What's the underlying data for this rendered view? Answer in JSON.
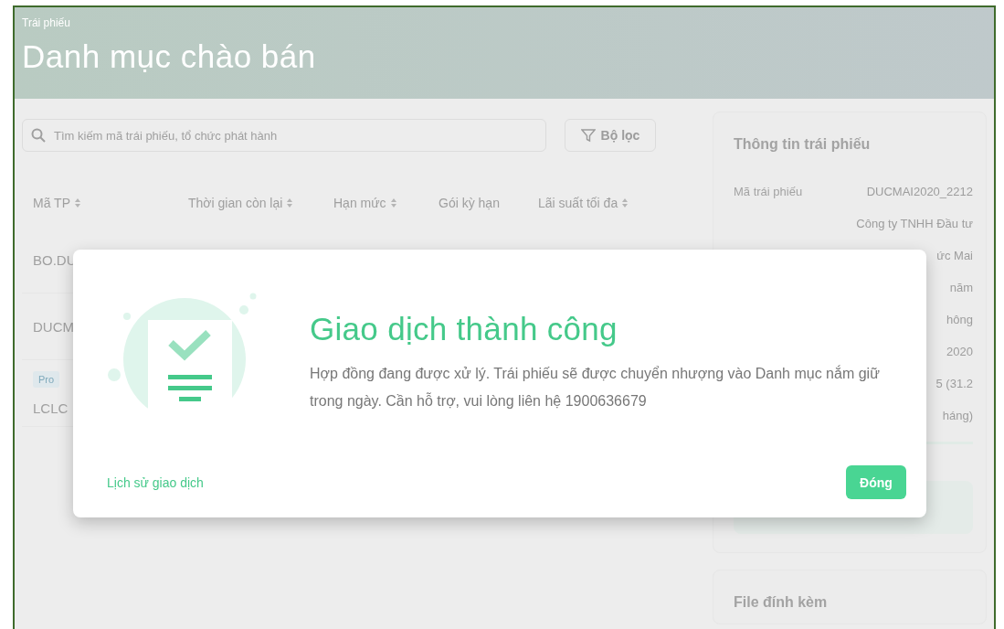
{
  "header": {
    "breadcrumb": "Trái phiếu",
    "title": "Danh mục chào bán"
  },
  "search": {
    "placeholder": "Tìm kiếm mã trái phiếu, tổ chức phát hành"
  },
  "filter_button": "Bộ lọc",
  "table": {
    "columns": [
      {
        "label": "Mã TP",
        "sortable": true
      },
      {
        "label": "Thời gian còn lại",
        "sortable": true
      },
      {
        "label": "Hạn mức",
        "sortable": true
      },
      {
        "label": "Gói kỳ hạn",
        "sortable": false
      },
      {
        "label": "Lãi suất tối đa",
        "sortable": true
      }
    ],
    "rows": [
      {
        "code": "BO.DU"
      },
      {
        "code": "DUCM"
      },
      {
        "badge": "Pro",
        "code": "LCLC"
      }
    ]
  },
  "info_panel": {
    "title": "Thông tin trái phiếu",
    "rows": [
      {
        "label": "Mã trái phiếu",
        "value": "DUCMAI2020_2212"
      },
      {
        "value": "Công ty TNHH Đầu tư"
      },
      {
        "value": "ức Mai"
      },
      {
        "value": "năm"
      },
      {
        "value": "hông"
      },
      {
        "value": "2020"
      },
      {
        "value": "5 (31.2"
      },
      {
        "value": "háng)"
      }
    ]
  },
  "attachments_title": "File đính kèm",
  "modal": {
    "title": "Giao dịch thành công",
    "message": "Hợp đồng đang được xử lý. Trái phiếu sẽ được chuyển nhượng vào Danh mục nắm giữ trong ngày. Cần hỗ trợ, vui lòng liên hệ 1900636679",
    "history_link": "Lịch sử giao dịch",
    "close_button": "Đóng"
  }
}
